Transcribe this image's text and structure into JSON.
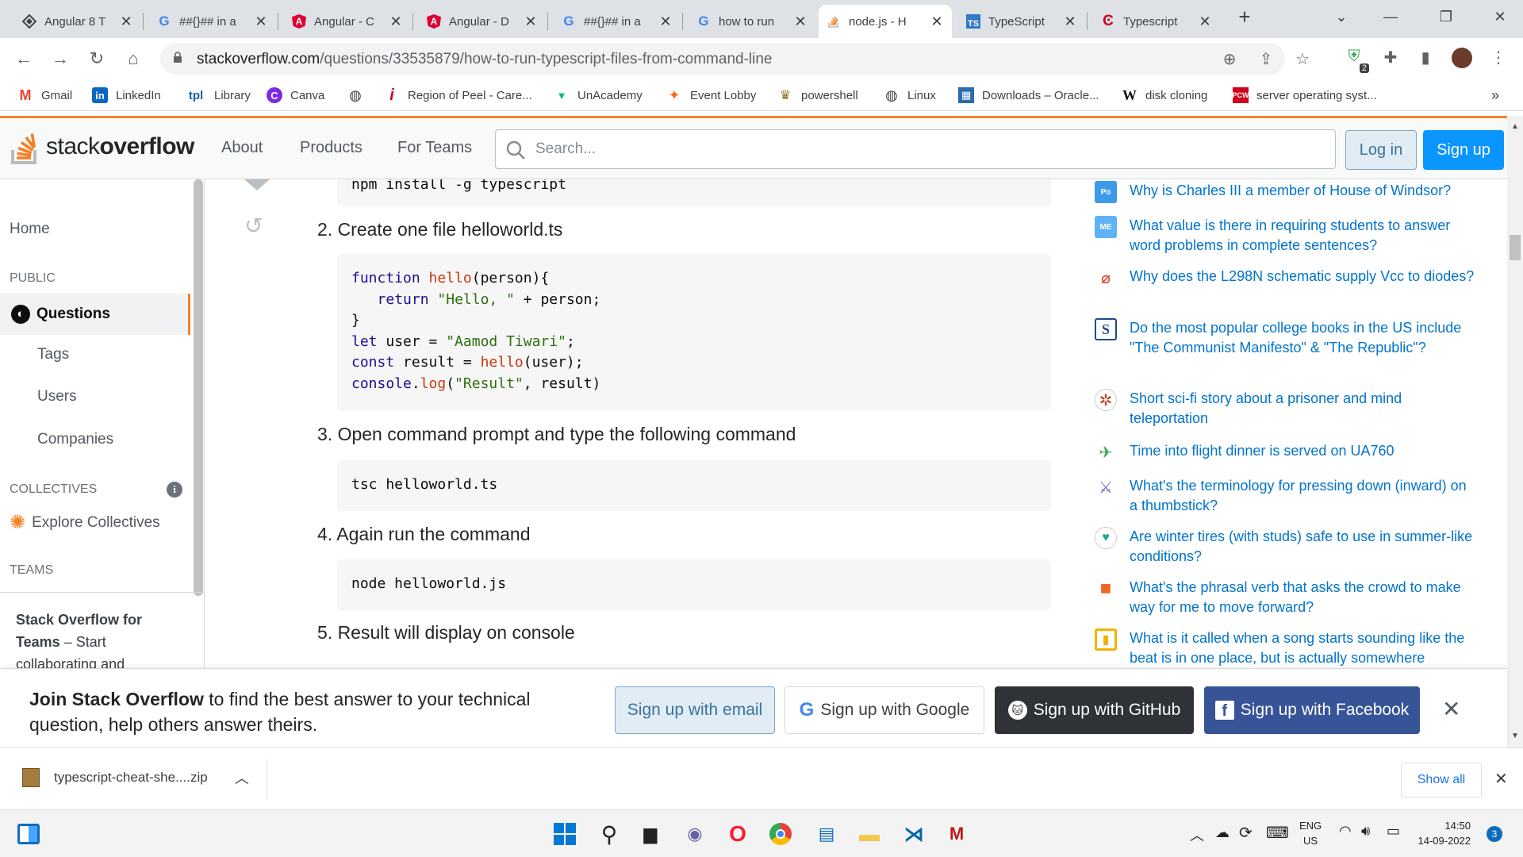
{
  "browser": {
    "tabs": [
      {
        "title": "Angular 8 T",
        "icon": "angular-alt-icon"
      },
      {
        "title": "##{}## in a",
        "icon": "google-icon"
      },
      {
        "title": "Angular - C",
        "icon": "angular-icon"
      },
      {
        "title": "Angular - D",
        "icon": "angular-icon"
      },
      {
        "title": "##{}## in a",
        "icon": "google-icon"
      },
      {
        "title": "how to run",
        "icon": "google-icon"
      },
      {
        "title": "node.js - H",
        "icon": "stackoverflow-icon"
      },
      {
        "title": "TypeScript",
        "icon": "typescript-icon"
      },
      {
        "title": "Typescript",
        "icon": "typescript-red-icon"
      }
    ],
    "url_host": "stackoverflow.com",
    "url_path": "/questions/33535879/how-to-run-typescript-files-from-command-line",
    "extension_badge": "2",
    "bookmarks": [
      "Gmail",
      "LinkedIn",
      "Library",
      "Canva",
      "",
      "Region of Peel - Care...",
      "UnAcademy",
      "Event Lobby",
      "powershell",
      "Linux",
      "Downloads – Oracle...",
      "disk cloning",
      "server operating syst..."
    ],
    "bookmarks_more": "»"
  },
  "so_header": {
    "logo_light": "stack",
    "logo_bold": "overflow",
    "nav": [
      "About",
      "Products",
      "For Teams"
    ],
    "search_placeholder": "Search...",
    "login": "Log in",
    "signup": "Sign up"
  },
  "left_nav": {
    "home": "Home",
    "public": "PUBLIC",
    "questions": "Questions",
    "tags": "Tags",
    "users": "Users",
    "companies": "Companies",
    "collectives": "COLLECTIVES",
    "explore": "Explore Collectives",
    "teams": "TEAMS",
    "teams_title": "Stack Overflow for Teams",
    "teams_text": " – Start collaborating and"
  },
  "answer": {
    "code0": "npm install -g typescript",
    "step2": "2. Create one file helloworld.ts",
    "code1": {
      "l1_kw": "function",
      "l1_fn": "hello",
      "l1_rest": "(person){",
      "l2_kw": "return",
      "l2_str": "\"Hello, \"",
      "l2_rest": " + person;",
      "l3": "}",
      "l4_kw": "let",
      "l4_mid": " user = ",
      "l4_str": "\"Aamod Tiwari\"",
      "l4_end": ";",
      "l5_kw": "const",
      "l5_mid": " result = ",
      "l5_fn": "hello",
      "l5_end": "(user);",
      "l6_obj": "console",
      "l6_dot": ".",
      "l6_fn": "log",
      "l6_open": "(",
      "l6_str": "\"Result\"",
      "l6_end": ", result)"
    },
    "step3": "3. Open command prompt and type the following command",
    "code2": "tsc helloworld.ts",
    "step4": "4. Again run the command",
    "code3": "node helloworld.js",
    "step5": "5. Result will display on console"
  },
  "hot_questions": [
    {
      "text": "Why is Charles III a member of House of Windsor?",
      "icon": "politics-icon",
      "color": "#3d9ae8",
      "label": "Po"
    },
    {
      "text": "What value is there in requiring students to answer word problems in complete sentences?",
      "icon": "math-educators-icon",
      "color": "#5eb3f5",
      "label": "ME"
    },
    {
      "text": "Why does the L298N schematic supply Vcc to diodes?",
      "icon": "electronics-icon",
      "color": "#e04a2f",
      "label": "⌀"
    },
    {
      "text": "Do the most popular college books in the US include \"The Communist Manifesto\" & \"The Republic\"?",
      "icon": "skeptics-icon",
      "color": "#1f4a8a",
      "label": "S"
    },
    {
      "text": "Short sci-fi story about a prisoner and mind teleportation",
      "icon": "scifi-icon",
      "color": "#c0392b",
      "label": "✲"
    },
    {
      "text": "Time into flight dinner is served on UA760",
      "icon": "travel-icon",
      "color": "#3aa757",
      "label": "✈"
    },
    {
      "text": "What's the terminology for pressing down (inward) on a thumbstick?",
      "icon": "gaming-icon",
      "color": "#5b6ec4",
      "label": "⚔"
    },
    {
      "text": "Are winter tires (with studs) safe to use in summer-like conditions?",
      "icon": "mechanics-icon",
      "color": "#2aa198",
      "label": "♥"
    },
    {
      "text": "What's the phrasal verb that asks the crowd to make way for me to move forward?",
      "icon": "english-icon",
      "color": "#f26522",
      "label": "■"
    },
    {
      "text": "What is it called when a song starts sounding like the beat is in one place, but is actually somewhere",
      "icon": "music-icon",
      "color": "#f0b400",
      "label": "▮"
    }
  ],
  "banner": {
    "bold": "Join Stack Overflow",
    "text": " to find the best answer to your technical question, help others answer theirs.",
    "email": "Sign up with email",
    "google": "Sign up with Google",
    "github": "Sign up with GitHub",
    "facebook": "Sign up with Facebook"
  },
  "download": {
    "file": "typescript-cheat-she....zip",
    "show_all": "Show all"
  },
  "taskbar": {
    "lang1": "ENG",
    "lang2": "US",
    "time": "14:50",
    "date": "14-09-2022",
    "notif": "3"
  }
}
